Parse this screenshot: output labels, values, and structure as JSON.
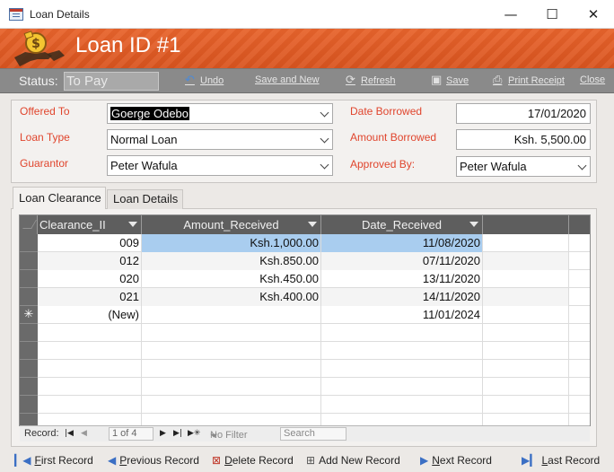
{
  "window": {
    "title": "Loan Details",
    "minimize_glyph": "—",
    "maximize_glyph": "☐",
    "close_glyph": "✕"
  },
  "header": {
    "loan_title": "Loan ID #1",
    "icon": "money-hand-icon"
  },
  "toolbar": {
    "status_label": "Status:",
    "status_value": "To Pay",
    "undo_label": "Undo",
    "save_new_label": "Save and New",
    "refresh_label": "Refresh",
    "save_label": "Save",
    "print_label": "Print Receipt",
    "close_label": "Close"
  },
  "form": {
    "offered_to_label": "Offered To",
    "offered_to_value": "Goerge Odebo",
    "loan_type_label": "Loan Type",
    "loan_type_value": "Normal Loan",
    "guarantor_label": "Guarantor",
    "guarantor_value": "Peter Wafula",
    "date_borrowed_label": "Date Borrowed",
    "date_borrowed_value": "17/01/2020",
    "amount_borrowed_label": "Amount Borrowed",
    "amount_borrowed_value": "Ksh. 5,500.00",
    "approved_by_label": "Approved By:",
    "approved_by_value": "Peter Wafula"
  },
  "tabs": [
    {
      "label": "Loan Clearance",
      "active": true
    },
    {
      "label": "Loan Details",
      "active": false
    }
  ],
  "grid": {
    "columns": [
      "Clearance_II",
      "Amount_Received",
      "Date_Received"
    ],
    "rows": [
      {
        "id": "009",
        "amount": "Ksh.1,000.00",
        "date": "11/08/2020"
      },
      {
        "id": "012",
        "amount": "Ksh.850.00",
        "date": "07/11/2020"
      },
      {
        "id": "020",
        "amount": "Ksh.450.00",
        "date": "13/11/2020"
      },
      {
        "id": "021",
        "amount": "Ksh.400.00",
        "date": "14/11/2020"
      }
    ],
    "new_row": {
      "marker": "✳",
      "id": "(New)",
      "date": "11/01/2024"
    }
  },
  "record_nav": {
    "record_label": "Record:",
    "position": "1 of 4",
    "filter_label": "No Filter",
    "search_placeholder": "Search"
  },
  "bottom_nav": {
    "first": "First Record",
    "previous": "Previous Record",
    "delete": "Delete Record",
    "add": "Add New Record",
    "next": "Next Record",
    "last": "Last Record"
  },
  "colors": {
    "header_orange": "#e0592a",
    "label_red": "#e0452d",
    "highlight_blue": "#a9cdef",
    "toolbar_gray": "#8a8a8a"
  }
}
